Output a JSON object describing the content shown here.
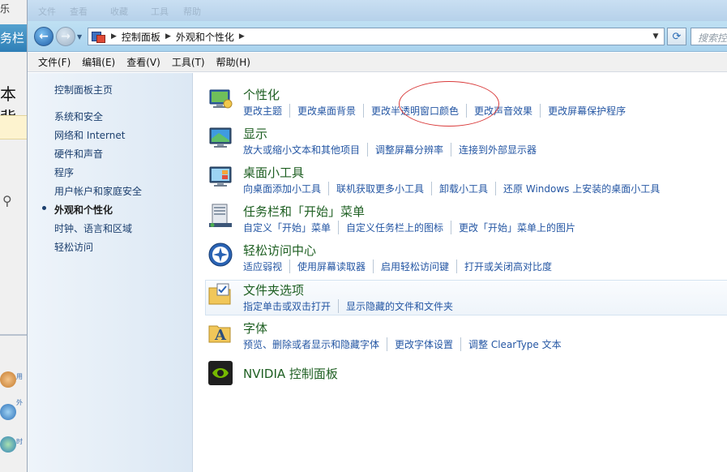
{
  "background_window": {
    "texts": [
      "乐",
      "务栏",
      "本背"
    ]
  },
  "titlebar": {
    "faint_items": [
      "文件",
      "查看",
      "收藏",
      "工具",
      "帮助"
    ]
  },
  "address_bar": {
    "crumbs": [
      "控制面板",
      "外观和个性化"
    ],
    "search_placeholder": "搜索控制"
  },
  "menu": [
    "文件(F)",
    "编辑(E)",
    "查看(V)",
    "工具(T)",
    "帮助(H)"
  ],
  "sidebar": {
    "items": [
      {
        "label": "控制面板主页"
      },
      {
        "label": "系统和安全"
      },
      {
        "label": "网络和 Internet"
      },
      {
        "label": "硬件和声音"
      },
      {
        "label": "程序"
      },
      {
        "label": "用户帐户和家庭安全"
      },
      {
        "label": "外观和个性化",
        "active": true
      },
      {
        "label": "时钟、语言和区域"
      },
      {
        "label": "轻松访问"
      }
    ]
  },
  "categories": [
    {
      "title": "个性化",
      "icon": "personalization-icon",
      "links": [
        "更改主题",
        "更改桌面背景",
        "更改半透明窗口颜色",
        "更改声音效果",
        "更改屏幕保护程序"
      ]
    },
    {
      "title": "显示",
      "icon": "display-icon",
      "links": [
        "放大或缩小文本和其他项目",
        "调整屏幕分辨率",
        "连接到外部显示器"
      ]
    },
    {
      "title": "桌面小工具",
      "icon": "gadgets-icon",
      "links": [
        "向桌面添加小工具",
        "联机获取更多小工具",
        "卸载小工具",
        "还原 Windows 上安装的桌面小工具"
      ]
    },
    {
      "title": "任务栏和「开始」菜单",
      "icon": "taskbar-icon",
      "links": [
        "自定义「开始」菜单",
        "自定义任务栏上的图标",
        "更改「开始」菜单上的图片"
      ]
    },
    {
      "title": "轻松访问中心",
      "icon": "ease-of-access-icon",
      "links": [
        "适应弱视",
        "使用屏幕读取器",
        "启用轻松访问键",
        "打开或关闭高对比度"
      ]
    },
    {
      "title": "文件夹选项",
      "icon": "folder-options-icon",
      "links": [
        "指定单击或双击打开",
        "显示隐藏的文件和文件夹"
      ]
    },
    {
      "title": "字体",
      "icon": "fonts-icon",
      "links": [
        "预览、删除或者显示和隐藏字体",
        "更改字体设置",
        "调整 ClearType 文本"
      ]
    },
    {
      "title": "NVIDIA 控制面板",
      "icon": "nvidia-icon",
      "links": []
    }
  ],
  "colors": {
    "category_title": "#1e5f22",
    "link": "#2456a3",
    "annotation": "#d93b3b"
  }
}
